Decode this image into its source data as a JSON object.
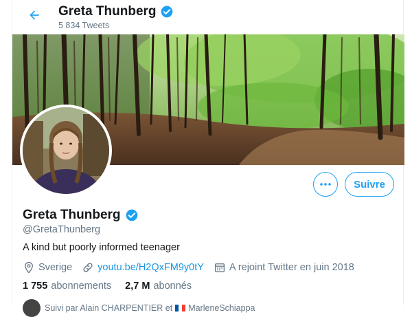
{
  "header": {
    "name": "Greta Thunberg",
    "tweet_count": "5 834 Tweets"
  },
  "profile": {
    "name": "Greta Thunberg",
    "handle": "@GretaThunberg",
    "bio": "A kind but poorly informed teenager",
    "location": "Sverige",
    "website": "youtu.be/H2QxFM9y0tY",
    "joined": "A rejoint Twitter en juin 2018",
    "follow_label": "Suivre",
    "following_count": "1 755",
    "following_label": "abonnements",
    "followers_count": "2,7 M",
    "followers_label": "abonnés"
  },
  "followed_by": {
    "prefix": "Suivi par Alain CHARPENTIER et",
    "name2": "MarleneSchiappa"
  },
  "colors": {
    "accent": "#1da1f2",
    "link": "#1b95e0",
    "muted": "#657786",
    "text": "#14171a"
  },
  "icons": [
    "back-arrow-icon",
    "verified-badge-icon",
    "more-options-icon",
    "location-icon",
    "link-icon",
    "calendar-icon"
  ]
}
